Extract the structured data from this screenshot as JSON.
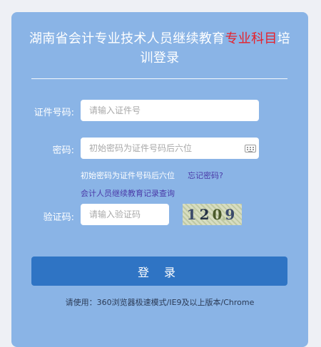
{
  "title": {
    "part1": "湖南省会计专业技术人员继续教育",
    "highlight": "专业科目",
    "part2": "培",
    "line2": "训登录"
  },
  "form": {
    "id_label": "证件号码:",
    "id_placeholder": "请输入证件号",
    "password_label": "密码:",
    "password_placeholder": "初始密码为证件号码后六位",
    "password_hint": "初始密码为证件号码后六位",
    "forgot_password": "忘记密码?",
    "records_link": "会计人员继续教育记录查询",
    "captcha_label": "验证码:",
    "captcha_placeholder": "请输入验证码",
    "captcha_digits": [
      "1",
      "2",
      "0",
      "9"
    ],
    "login_button": "登 录"
  },
  "footer": {
    "note": "请使用：360浏览器极速模式/IE9及以上版本/Chrome"
  },
  "colors": {
    "panel": "#8ab4e6",
    "button": "#2f74c4",
    "highlight": "#e8202a",
    "link": "#4a3aa8"
  },
  "icons": {
    "password_field": "keyboard-icon"
  }
}
